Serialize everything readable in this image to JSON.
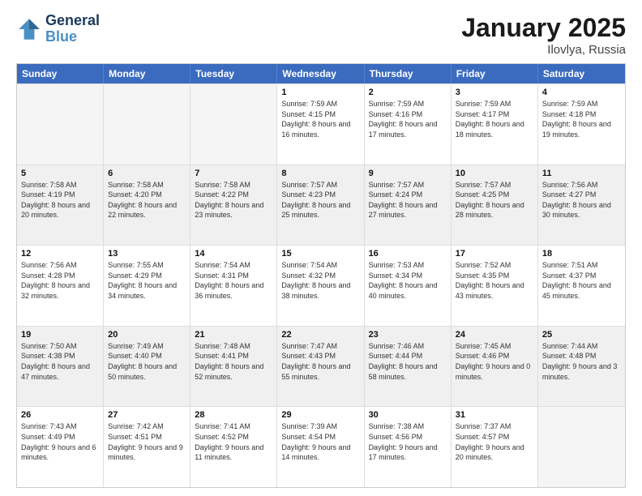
{
  "logo": {
    "line1": "General",
    "line2": "Blue"
  },
  "title": "January 2025",
  "subtitle": "Ilovlya, Russia",
  "header_days": [
    "Sunday",
    "Monday",
    "Tuesday",
    "Wednesday",
    "Thursday",
    "Friday",
    "Saturday"
  ],
  "rows": [
    [
      {
        "day": "",
        "content": "",
        "empty": true
      },
      {
        "day": "",
        "content": "",
        "empty": true
      },
      {
        "day": "",
        "content": "",
        "empty": true
      },
      {
        "day": "1",
        "content": "Sunrise: 7:59 AM\nSunset: 4:15 PM\nDaylight: 8 hours and 16 minutes."
      },
      {
        "day": "2",
        "content": "Sunrise: 7:59 AM\nSunset: 4:16 PM\nDaylight: 8 hours and 17 minutes."
      },
      {
        "day": "3",
        "content": "Sunrise: 7:59 AM\nSunset: 4:17 PM\nDaylight: 8 hours and 18 minutes."
      },
      {
        "day": "4",
        "content": "Sunrise: 7:59 AM\nSunset: 4:18 PM\nDaylight: 8 hours and 19 minutes."
      }
    ],
    [
      {
        "day": "5",
        "content": "Sunrise: 7:58 AM\nSunset: 4:19 PM\nDaylight: 8 hours and 20 minutes."
      },
      {
        "day": "6",
        "content": "Sunrise: 7:58 AM\nSunset: 4:20 PM\nDaylight: 8 hours and 22 minutes."
      },
      {
        "day": "7",
        "content": "Sunrise: 7:58 AM\nSunset: 4:22 PM\nDaylight: 8 hours and 23 minutes."
      },
      {
        "day": "8",
        "content": "Sunrise: 7:57 AM\nSunset: 4:23 PM\nDaylight: 8 hours and 25 minutes."
      },
      {
        "day": "9",
        "content": "Sunrise: 7:57 AM\nSunset: 4:24 PM\nDaylight: 8 hours and 27 minutes."
      },
      {
        "day": "10",
        "content": "Sunrise: 7:57 AM\nSunset: 4:25 PM\nDaylight: 8 hours and 28 minutes."
      },
      {
        "day": "11",
        "content": "Sunrise: 7:56 AM\nSunset: 4:27 PM\nDaylight: 8 hours and 30 minutes."
      }
    ],
    [
      {
        "day": "12",
        "content": "Sunrise: 7:56 AM\nSunset: 4:28 PM\nDaylight: 8 hours and 32 minutes."
      },
      {
        "day": "13",
        "content": "Sunrise: 7:55 AM\nSunset: 4:29 PM\nDaylight: 8 hours and 34 minutes."
      },
      {
        "day": "14",
        "content": "Sunrise: 7:54 AM\nSunset: 4:31 PM\nDaylight: 8 hours and 36 minutes."
      },
      {
        "day": "15",
        "content": "Sunrise: 7:54 AM\nSunset: 4:32 PM\nDaylight: 8 hours and 38 minutes."
      },
      {
        "day": "16",
        "content": "Sunrise: 7:53 AM\nSunset: 4:34 PM\nDaylight: 8 hours and 40 minutes."
      },
      {
        "day": "17",
        "content": "Sunrise: 7:52 AM\nSunset: 4:35 PM\nDaylight: 8 hours and 43 minutes."
      },
      {
        "day": "18",
        "content": "Sunrise: 7:51 AM\nSunset: 4:37 PM\nDaylight: 8 hours and 45 minutes."
      }
    ],
    [
      {
        "day": "19",
        "content": "Sunrise: 7:50 AM\nSunset: 4:38 PM\nDaylight: 8 hours and 47 minutes."
      },
      {
        "day": "20",
        "content": "Sunrise: 7:49 AM\nSunset: 4:40 PM\nDaylight: 8 hours and 50 minutes."
      },
      {
        "day": "21",
        "content": "Sunrise: 7:48 AM\nSunset: 4:41 PM\nDaylight: 8 hours and 52 minutes."
      },
      {
        "day": "22",
        "content": "Sunrise: 7:47 AM\nSunset: 4:43 PM\nDaylight: 8 hours and 55 minutes."
      },
      {
        "day": "23",
        "content": "Sunrise: 7:46 AM\nSunset: 4:44 PM\nDaylight: 8 hours and 58 minutes."
      },
      {
        "day": "24",
        "content": "Sunrise: 7:45 AM\nSunset: 4:46 PM\nDaylight: 9 hours and 0 minutes."
      },
      {
        "day": "25",
        "content": "Sunrise: 7:44 AM\nSunset: 4:48 PM\nDaylight: 9 hours and 3 minutes."
      }
    ],
    [
      {
        "day": "26",
        "content": "Sunrise: 7:43 AM\nSunset: 4:49 PM\nDaylight: 9 hours and 6 minutes."
      },
      {
        "day": "27",
        "content": "Sunrise: 7:42 AM\nSunset: 4:51 PM\nDaylight: 9 hours and 9 minutes."
      },
      {
        "day": "28",
        "content": "Sunrise: 7:41 AM\nSunset: 4:52 PM\nDaylight: 9 hours and 11 minutes."
      },
      {
        "day": "29",
        "content": "Sunrise: 7:39 AM\nSunset: 4:54 PM\nDaylight: 9 hours and 14 minutes."
      },
      {
        "day": "30",
        "content": "Sunrise: 7:38 AM\nSunset: 4:56 PM\nDaylight: 9 hours and 17 minutes."
      },
      {
        "day": "31",
        "content": "Sunrise: 7:37 AM\nSunset: 4:57 PM\nDaylight: 9 hours and 20 minutes."
      },
      {
        "day": "",
        "content": "",
        "empty": true
      }
    ]
  ]
}
